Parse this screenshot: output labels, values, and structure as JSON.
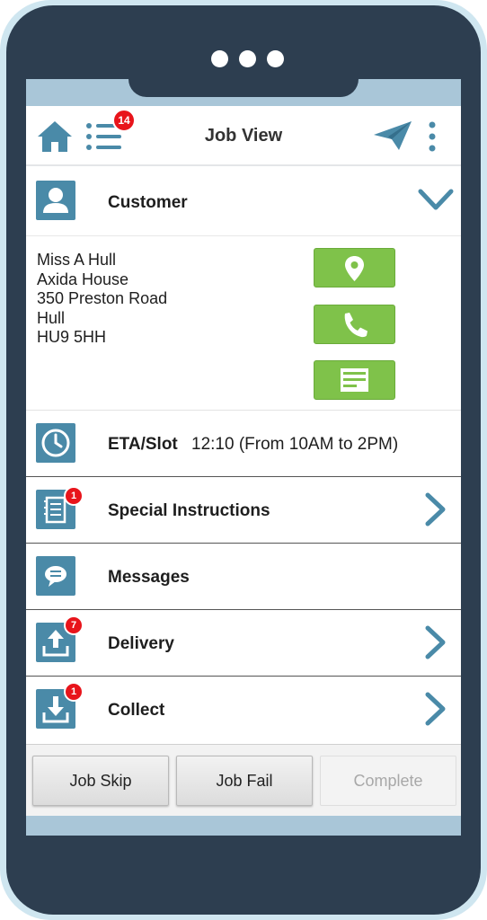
{
  "header": {
    "title": "Job View",
    "list_badge": "14"
  },
  "customer": {
    "label": "Customer",
    "address_lines": [
      "Miss A Hull",
      "Axida House",
      "350 Preston Road",
      "Hull",
      "HU9 5HH"
    ]
  },
  "eta": {
    "label": "ETA/Slot",
    "value": "12:10 (From 10AM to 2PM)"
  },
  "special_instructions": {
    "label": "Special Instructions",
    "badge": "1"
  },
  "messages": {
    "label": "Messages"
  },
  "delivery": {
    "label": "Delivery",
    "badge": "7"
  },
  "collect": {
    "label": "Collect",
    "badge": "1"
  },
  "actions": {
    "job_skip": "Job Skip",
    "job_fail": "Job Fail",
    "complete": "Complete"
  },
  "colors": {
    "accent": "#4a8aa8",
    "action_green": "#7fc24a",
    "badge_red": "#e8141b",
    "frame": "#2d3e50"
  },
  "icons": [
    "home-icon",
    "list-icon",
    "send-icon",
    "more-icon",
    "person-icon",
    "chevron-down-icon",
    "map-pin-icon",
    "phone-icon",
    "notes-icon",
    "clock-icon",
    "notepad-icon",
    "chat-icon",
    "upload-icon",
    "download-icon",
    "chevron-right-icon"
  ]
}
